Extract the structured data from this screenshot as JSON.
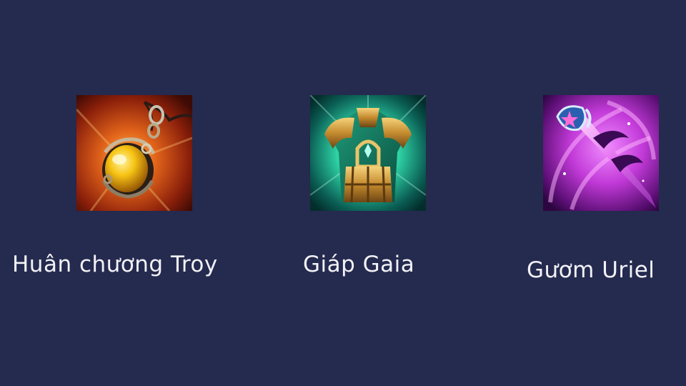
{
  "items": [
    {
      "name": "Huân chương Troy",
      "icon": "golden-amulet-icon"
    },
    {
      "name": "Giáp Gaia",
      "icon": "green-armor-icon"
    },
    {
      "name": "Gươm Uriel",
      "icon": "pink-sword-icon"
    }
  ],
  "colors": {
    "background": "#252a4f",
    "text": "#f2f2f6",
    "amulet_glow": "#e8731a",
    "armor_glow": "#2fd6a8",
    "sword_glow": "#c23ad8"
  }
}
